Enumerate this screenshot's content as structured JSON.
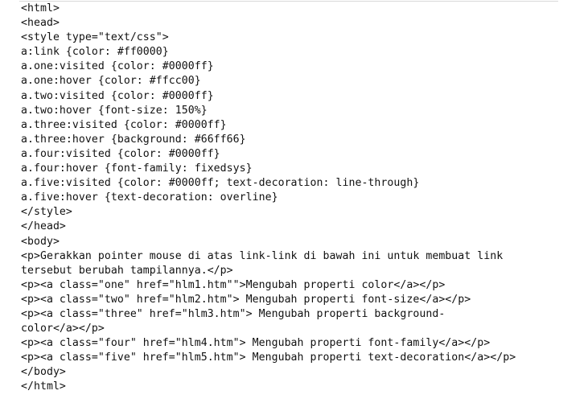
{
  "code": {
    "lines": [
      "<html>",
      "<head>",
      "<style type=\"text/css\">",
      "a:link {color: #ff0000}",
      "a.one:visited {color: #0000ff}",
      "a.one:hover {color: #ffcc00}",
      "a.two:visited {color: #0000ff}",
      "a.two:hover {font-size: 150%}",
      "a.three:visited {color: #0000ff}",
      "a.three:hover {background: #66ff66}",
      "a.four:visited {color: #0000ff}",
      "a.four:hover {font-family: fixedsys}",
      "a.five:visited {color: #0000ff; text-decoration: line-through}",
      "a.five:hover {text-decoration: overline}",
      "</style>",
      "</head>",
      "<body>",
      "<p>Gerakkan pointer mouse di atas link-link di bawah ini untuk membuat link",
      "tersebut berubah tampilannya.</p>",
      "<p><a class=\"one\" href=\"hlm1.htm\"\">Mengubah properti color</a></p>",
      "<p><a class=\"two\" href=\"hlm2.htm\"> Mengubah properti font-size</a></p>",
      "<p><a class=\"three\" href=\"hlm3.htm\"> Mengubah properti background-",
      "color</a></p>",
      "<p><a class=\"four\" href=\"hlm4.htm\"> Mengubah properti font-family</a></p>",
      "<p><a class=\"five\" href=\"hlm5.htm\"> Mengubah properti text-decoration</a></p>",
      "</body>",
      "</html>"
    ]
  }
}
